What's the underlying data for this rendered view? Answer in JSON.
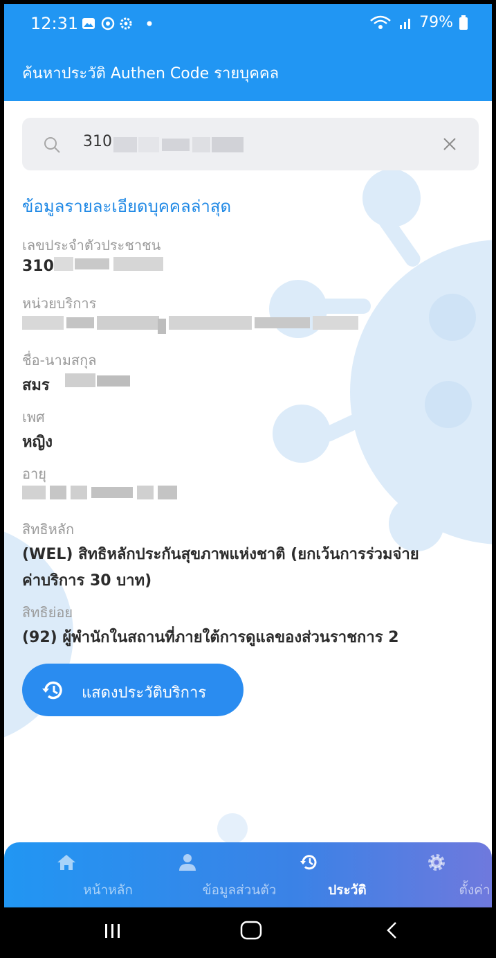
{
  "status_bar": {
    "time": "12:31",
    "battery": "79%"
  },
  "app_bar": {
    "title": "ค้นหาประวัติ Authen Code รายบุคคล"
  },
  "search": {
    "value": "310",
    "icon": "search-icon",
    "clear_icon": "close-icon"
  },
  "details": {
    "section_title": "ข้อมูลรายละเอียดบุคคลล่าสุด",
    "fields": [
      {
        "label": "เลขประจำตัวประชาชน",
        "value": "310"
      },
      {
        "label": "หน่วยบริการ",
        "value": ""
      },
      {
        "label": "ชื่อ-นามสกุล",
        "value": "สมร"
      },
      {
        "label": "เพศ",
        "value": "หญิง"
      },
      {
        "label": "อายุ",
        "value": ""
      },
      {
        "label": "สิทธิหลัก",
        "value": "(WEL) สิทธิหลักประกันสุขภาพแห่งชาติ (ยกเว้นการร่วมจ่าย",
        "value_line2": "ค่าบริการ 30 บาท)"
      },
      {
        "label": "สิทธิย่อย",
        "value": "(92) ผู้พำนักในสถานที่ภายใต้การดูแลของส่วนราชการ 2"
      }
    ]
  },
  "history_button": {
    "label": "แสดงประวัติบริการ",
    "icon": "history-icon"
  },
  "bottom_nav": {
    "items": [
      {
        "label": "หน้าหลัก",
        "icon": "home-icon",
        "active": false
      },
      {
        "label": "ข้อมูลส่วนตัว",
        "icon": "person-icon",
        "active": false
      },
      {
        "label": "ประวัติ",
        "icon": "history-icon",
        "active": true
      },
      {
        "label": "ตั้งค่า",
        "icon": "gear-icon",
        "active": false
      }
    ]
  },
  "colors": {
    "primary": "#2196f3",
    "section_title": "#1e88e5",
    "virus_decoration": "#d6e8f8"
  }
}
